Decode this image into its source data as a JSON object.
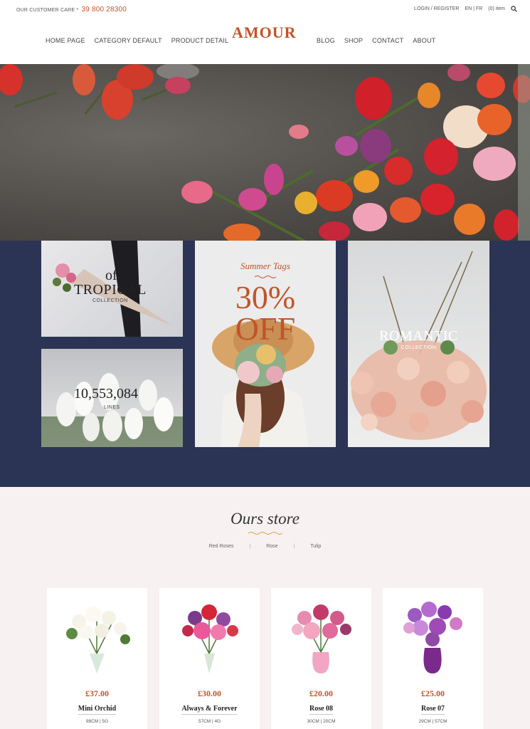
{
  "topbar": {
    "care_label": "OUR CUSTOMER CARE *",
    "phone": "39 800 28300",
    "login": "LOGIN / REGISTER",
    "lang_en": "EN",
    "lang_sep": "|",
    "lang_fr": "FR",
    "cart": "(0) item"
  },
  "nav": {
    "logo": "AMOUR",
    "left": [
      "HOME PAGE",
      "CATEGORY DEFAULT",
      "PRODUCT DETAIL"
    ],
    "right": [
      "BLOG",
      "SHOP",
      "CONTACT",
      "ABOUT"
    ]
  },
  "collections": {
    "tropical": {
      "of": "of",
      "title": "TROPICAL",
      "sub": "COLLECTION"
    },
    "lines": {
      "number": "10,553,084",
      "sub": "LINES"
    },
    "summer": {
      "tag": "Summer Tags",
      "discount": "30%",
      "off": "OFF"
    },
    "romantic": {
      "title": "ROMANTIC",
      "sub": "COLLECTION"
    }
  },
  "store": {
    "title": "Ours store",
    "filters": [
      "Red Roses",
      "Rose",
      "Tulip"
    ],
    "products": [
      {
        "price": "£37.00",
        "name": "Mini Orchid",
        "meta": "98CM | 5G"
      },
      {
        "price": "£30.00",
        "name": "Always & Forever",
        "meta": "57CM | 4G"
      },
      {
        "price": "£20.00",
        "name": "Rose 08",
        "meta": "30CM | 20CM"
      },
      {
        "price": "£25.00",
        "name": "Rose 07",
        "meta": "29CM | 57CM"
      }
    ]
  },
  "colors": {
    "accent": "#c0542a",
    "band": "#2b3454",
    "store_bg": "#f8f1f1"
  }
}
